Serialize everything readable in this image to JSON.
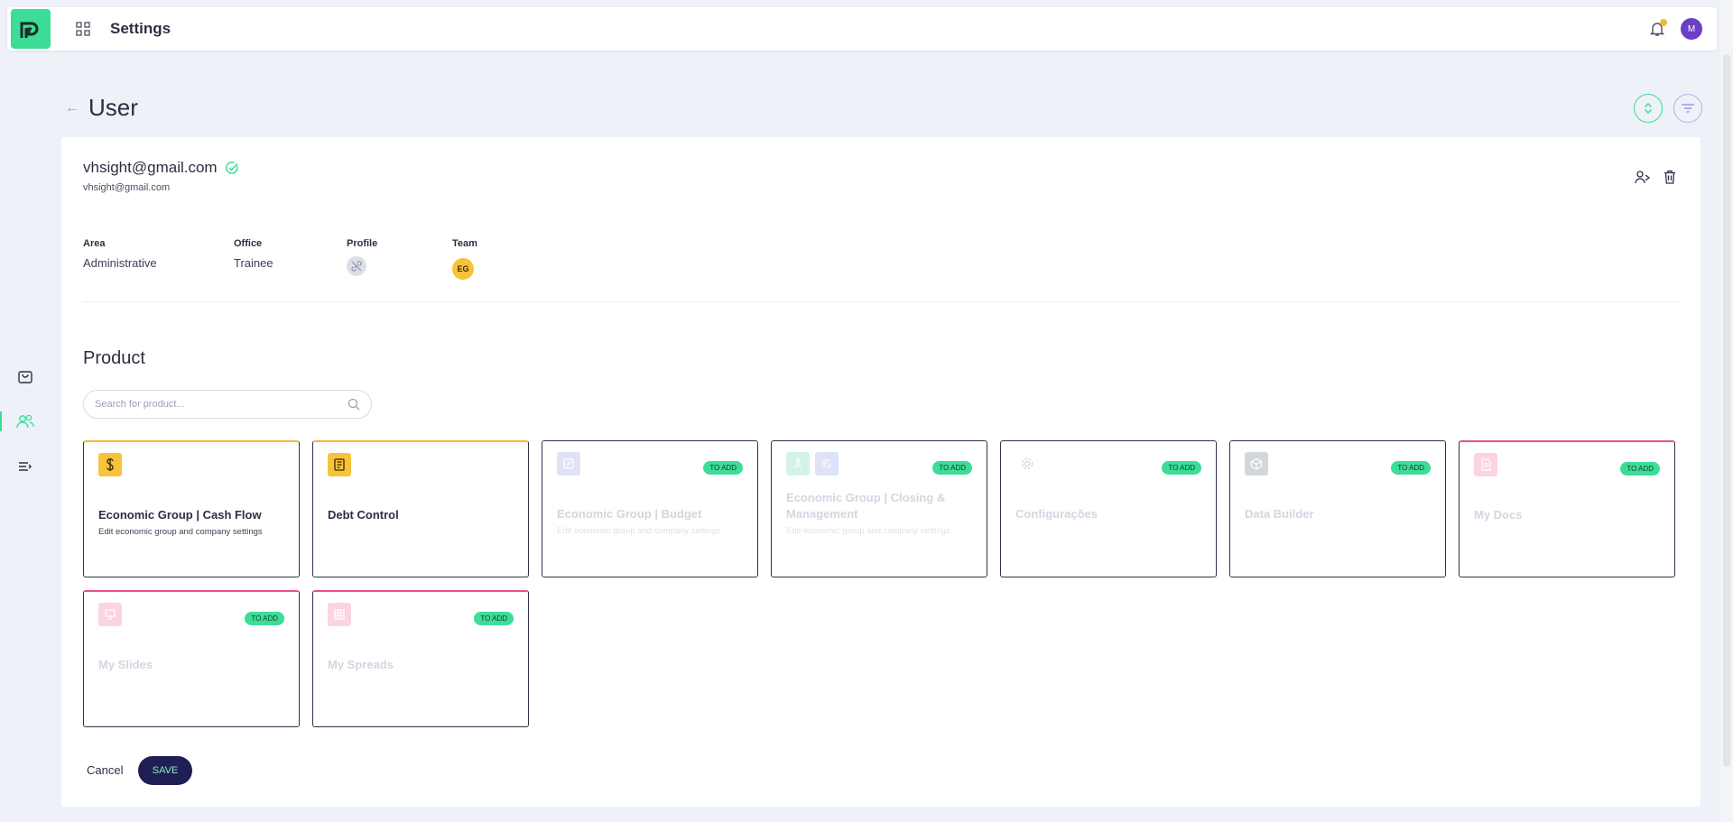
{
  "topbar": {
    "title": "Settings",
    "avatar_initial": "M"
  },
  "page": {
    "title": "User"
  },
  "user": {
    "email_title": "vhsight@gmail.com",
    "email_sub": "vhsight@gmail.com",
    "fields": {
      "area_label": "Area",
      "area_value": "Administrative",
      "office_label": "Office",
      "office_value": "Trainee",
      "profile_label": "Profile",
      "team_label": "Team",
      "team_value": "EG"
    }
  },
  "product": {
    "section_title": "Product",
    "search_placeholder": "Search for product...",
    "items": [
      {
        "name": "Economic Group | Cash Flow",
        "desc": "Edit economic group and company settings",
        "badge": "",
        "icon": "dollar-icon",
        "icon_color": "#f7c23c",
        "enabled": true
      },
      {
        "name": "Debt Control",
        "desc": "",
        "badge": "",
        "icon": "ledger-icon",
        "icon_color": "#f7c23c",
        "enabled": true
      },
      {
        "name": "Economic Group | Budget",
        "desc": "Edit economic group and company settings",
        "badge": "TO ADD",
        "icon": "edit-document-icon",
        "icon_color": "#dfe3f7",
        "enabled": false
      },
      {
        "name": "Economic Group | Closing & Management",
        "desc": "Edit economic group and company settings",
        "badge": "TO ADD",
        "icon": "hierarchy-icon",
        "icon_color": "#d4f3e6",
        "enabled": false
      },
      {
        "name": "Configurações",
        "desc": "",
        "badge": "TO ADD",
        "icon": "gear-icon",
        "icon_color": "#ffffff",
        "enabled": false
      },
      {
        "name": "Data Builder",
        "desc": "",
        "badge": "TO ADD",
        "icon": "cube-icon",
        "icon_color": "#d4d6de",
        "enabled": false
      },
      {
        "name": "My Docs",
        "desc": "",
        "badge": "TO ADD",
        "icon": "document-icon",
        "icon_color": "#fbd3e2",
        "enabled": false
      },
      {
        "name": "My Slides",
        "desc": "",
        "badge": "TO ADD",
        "icon": "presentation-icon",
        "icon_color": "#fbd3e2",
        "enabled": false
      },
      {
        "name": "My Spreads",
        "desc": "",
        "badge": "TO ADD",
        "icon": "spreadsheet-icon",
        "icon_color": "#fbd3e2",
        "enabled": false
      }
    ]
  },
  "actions": {
    "cancel_label": "Cancel",
    "save_label": "SAVE"
  },
  "colors": {
    "accent": "#3ddc97",
    "primary_dark": "#1f1f55",
    "warning": "#f5b82e"
  }
}
